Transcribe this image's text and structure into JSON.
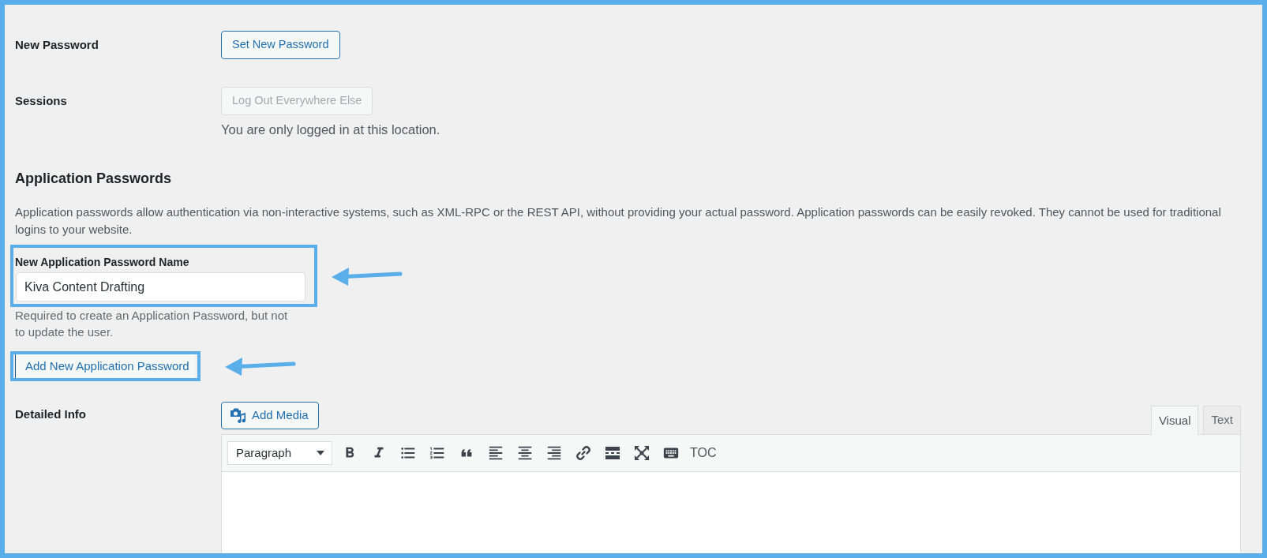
{
  "rows": [
    {
      "label": "New Password",
      "button": {
        "label": "Set New Password",
        "disabled": false
      }
    },
    {
      "label": "Sessions",
      "button": {
        "label": "Log Out Everywhere Else",
        "disabled": true
      },
      "note": "You are only logged in at this location."
    }
  ],
  "application_passwords": {
    "heading": "Application Passwords",
    "description": "Application passwords allow authentication via non-interactive systems, such as XML-RPC or the REST API, without providing your actual password. Application passwords can be easily revoked. They cannot be used for traditional logins to your website.",
    "name_field": {
      "label": "New Application Password Name",
      "value": "Kiva Content Drafting",
      "highlighted": true
    },
    "help": "Required to create an Application Password, but not to update the user.",
    "add_button": {
      "label": "Add New Application Password",
      "highlighted": true
    }
  },
  "detailed_info": {
    "label": "Detailed Info",
    "add_media": {
      "label": "Add Media"
    },
    "tabs": [
      {
        "label": "Visual",
        "selected": true
      },
      {
        "label": "Text",
        "selected": false
      }
    ],
    "format_select": {
      "value": "Paragraph"
    },
    "toc": {
      "label": "TOC"
    }
  }
}
